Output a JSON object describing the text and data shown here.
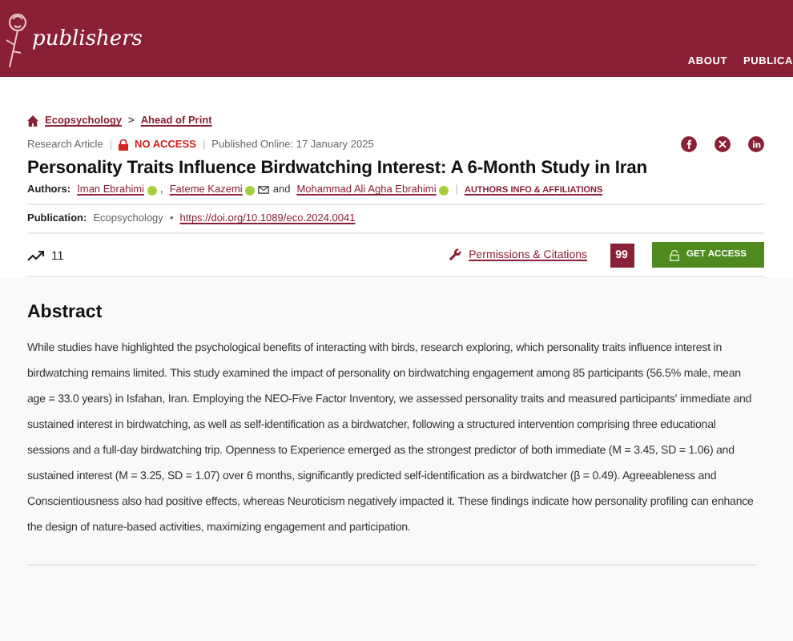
{
  "header": {
    "logo": "publishers",
    "nav": [
      "ABOUT",
      "PUBLICA"
    ]
  },
  "breadcrumb": {
    "links": [
      "Ecopsychology",
      "Ahead of Print"
    ],
    "separator": ">"
  },
  "meta": [
    {
      "kind": "type",
      "text": "Research Article"
    },
    {
      "kind": "divider",
      "text": "|"
    },
    {
      "kind": "access",
      "text": "NO ACCESS"
    },
    {
      "kind": "divider",
      "text": "|"
    },
    {
      "kind": "date",
      "text": "Published Online: 17 January 2025"
    }
  ],
  "title": "Personality Traits Influence Birdwatching Interest: A 6-Month Study in Iran",
  "authors_label": "Authors:",
  "authors": [
    {
      "name": "Iman Ebrahimi",
      "orcid": true,
      "email": false,
      "separator": ","
    },
    {
      "name": "Fateme Kazemi",
      "orcid": true,
      "email": true,
      "separator": "and"
    },
    {
      "name": "Mohammad Ali Agha Ebrahimi",
      "orcid": true,
      "email": false
    }
  ],
  "authors_divider": "|",
  "authors_info": "AUTHORS INFO & AFFILIATIONS",
  "publication": {
    "label": "Publication:",
    "journal": "Ecopsychology",
    "bullet": "•",
    "doi": "https://doi.org/10.1089/eco.2024.0041"
  },
  "metrics": "11",
  "actions": {
    "permissions": "Permissions & Citations",
    "cite": "99",
    "access": "GET ACCESS"
  },
  "abstract": {
    "heading": "Abstract",
    "text": "While studies have highlighted the psychological benefits of interacting with birds, research exploring, which personality traits influence interest in birdwatching remains limited. This study examined the impact of personality on birdwatching engagement among 85 participants (56.5% male, mean age = 33.0 years) in Isfahan, Iran. Employing the NEO-Five Factor Inventory, we assessed personality traits and measured participants' immediate and sustained interest in birdwatching, as well as self-identification as a birdwatcher, following a structured intervention comprising three educational sessions and a full-day birdwatching trip. Openness to Experience emerged as the strongest predictor of both immediate (M = 3.45, SD = 1.06) and sustained interest (M = 3.25, SD = 1.07) over 6 months, significantly predicted self-identification as a birdwatcher (β = 0.49). Agreeableness and Conscientiousness also had positive effects, whereas Neuroticism negatively impacted it. These findings indicate how personality profiling can enhance the design of nature-based activities, maximizing engagement and participation."
  }
}
